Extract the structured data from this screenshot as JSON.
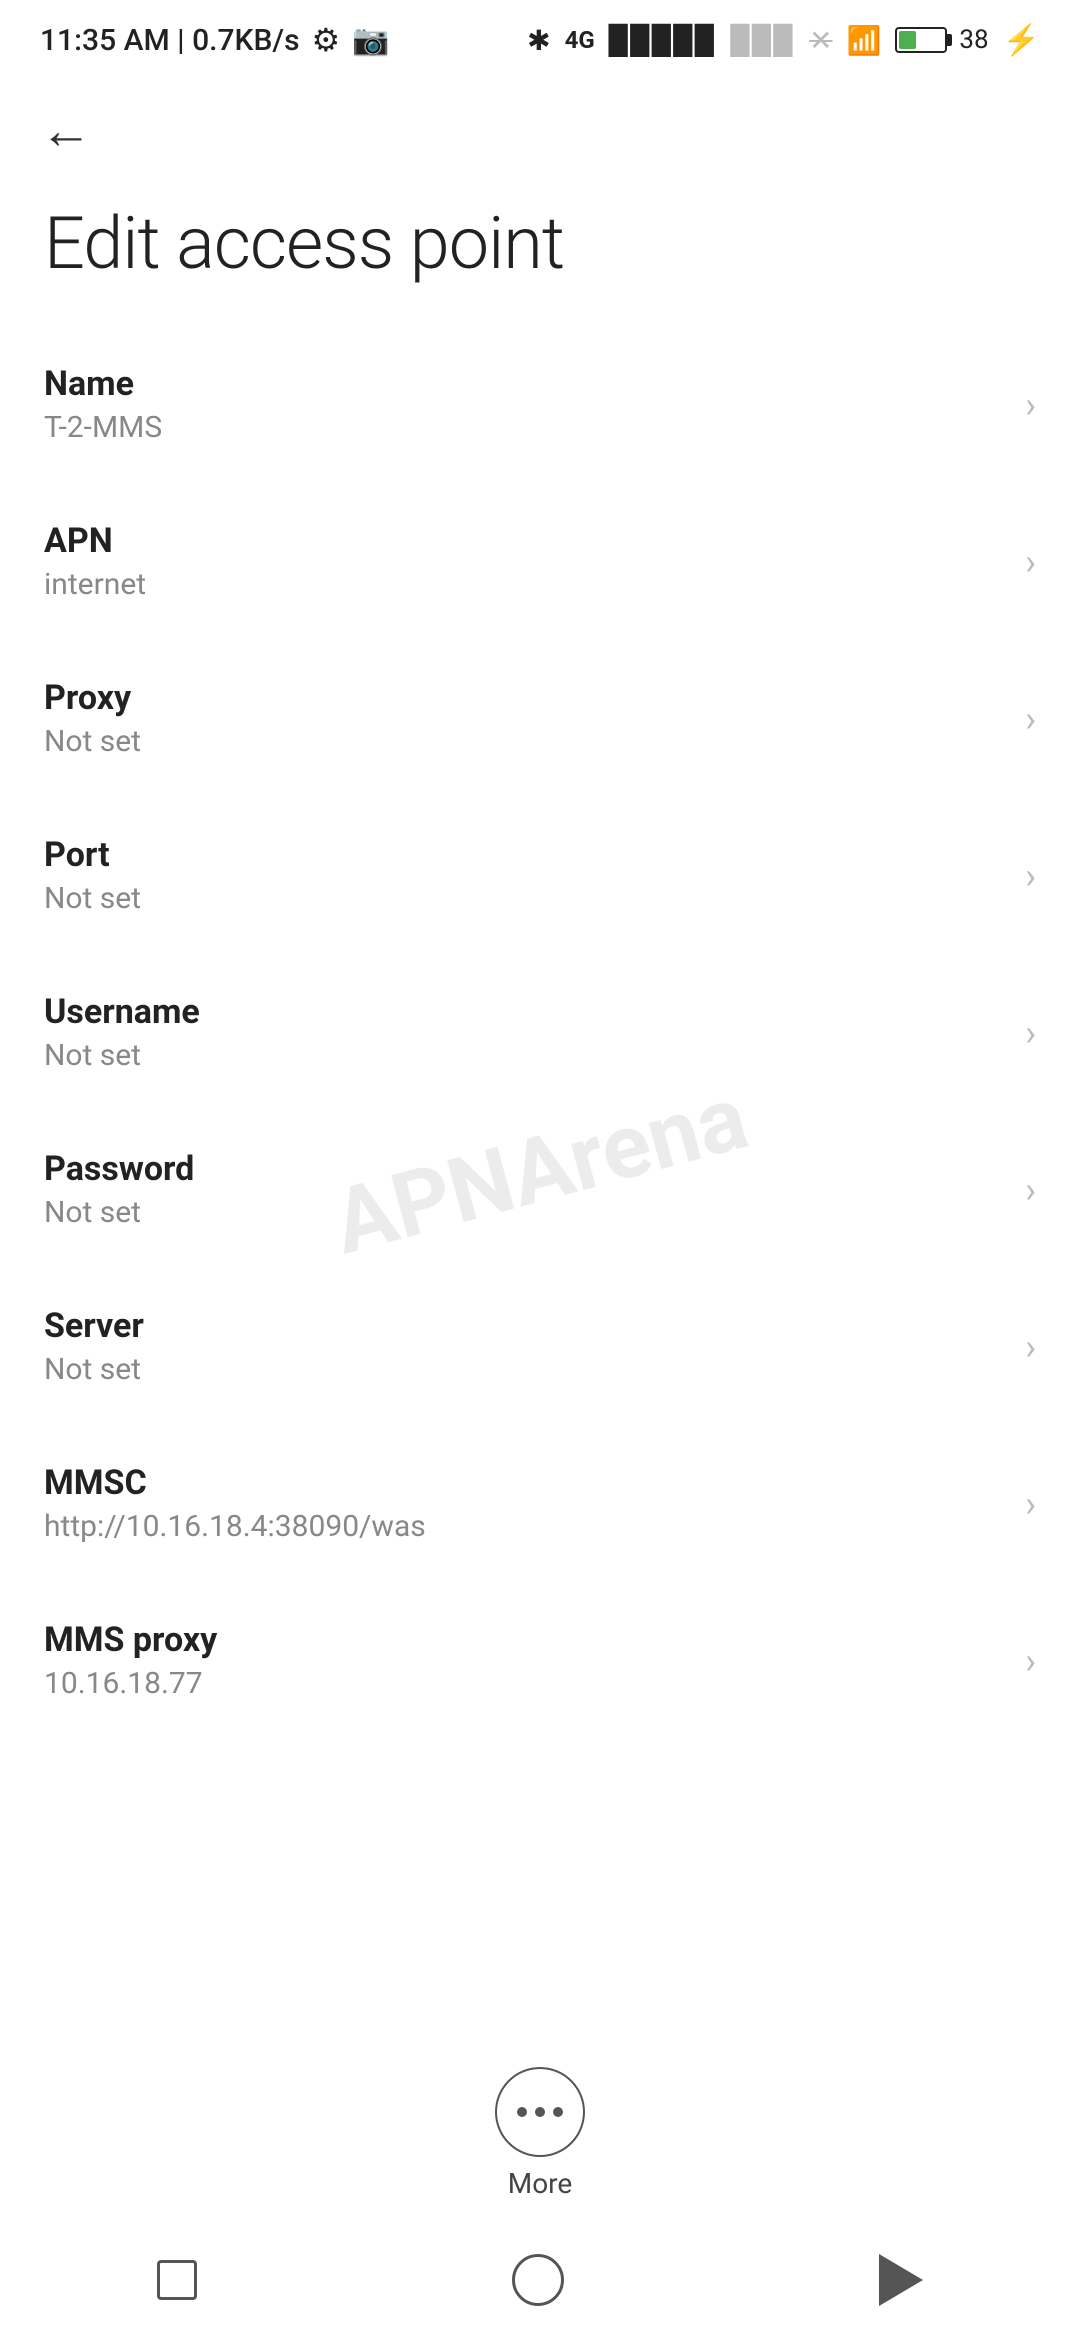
{
  "statusBar": {
    "time": "11:35 AM | 0.7KB/s",
    "batteryPercent": "38"
  },
  "page": {
    "title": "Edit access point",
    "backLabel": "Back"
  },
  "settings": [
    {
      "id": "name",
      "label": "Name",
      "value": "T-2-MMS"
    },
    {
      "id": "apn",
      "label": "APN",
      "value": "internet"
    },
    {
      "id": "proxy",
      "label": "Proxy",
      "value": "Not set"
    },
    {
      "id": "port",
      "label": "Port",
      "value": "Not set"
    },
    {
      "id": "username",
      "label": "Username",
      "value": "Not set"
    },
    {
      "id": "password",
      "label": "Password",
      "value": "Not set"
    },
    {
      "id": "server",
      "label": "Server",
      "value": "Not set"
    },
    {
      "id": "mmsc",
      "label": "MMSC",
      "value": "http://10.16.18.4:38090/was"
    },
    {
      "id": "mms-proxy",
      "label": "MMS proxy",
      "value": "10.16.18.77"
    }
  ],
  "moreButton": {
    "label": "More"
  },
  "watermark": "APNArena"
}
